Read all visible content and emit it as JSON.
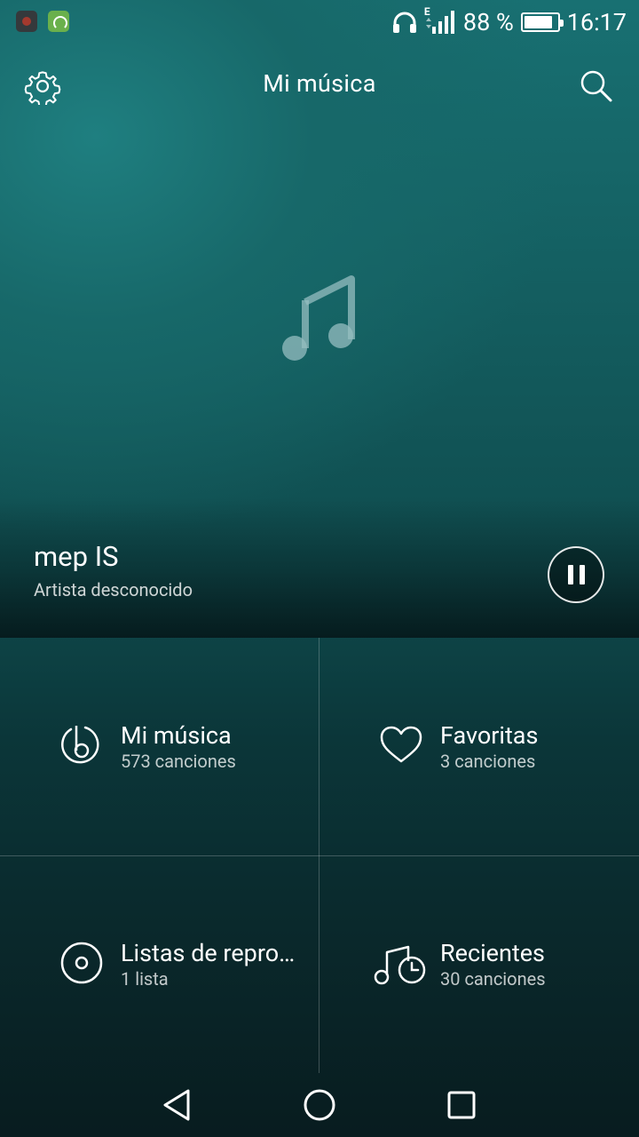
{
  "status_bar": {
    "signal_label": "E",
    "battery_text": "88 %",
    "battery_level": 0.88,
    "time": "16:17",
    "icons": [
      "app-notification-icon",
      "headset-app-icon",
      "headphones-icon",
      "signal-icon",
      "battery-icon"
    ]
  },
  "header": {
    "title": "Mi música",
    "settings_icon": "gear-icon",
    "search_icon": "search-icon"
  },
  "now_playing": {
    "title": "mep IS",
    "artist": "Artista desconocido",
    "control": "pause"
  },
  "categories": [
    {
      "title": "Mi música",
      "subtitle": "573 canciones",
      "icon": "music-library-icon"
    },
    {
      "title": "Favoritas",
      "subtitle": "3 canciones",
      "icon": "heart-icon"
    },
    {
      "title": "Listas de repro…",
      "subtitle": "1 lista",
      "icon": "disc-icon"
    },
    {
      "title": "Recientes",
      "subtitle": "30 canciones",
      "icon": "recent-music-icon"
    }
  ],
  "colors": {
    "accent": "#1f7f80",
    "background_dark": "#081c1f"
  },
  "nav": {
    "back": "back-icon",
    "home": "home-icon",
    "recent": "recent-apps-icon"
  }
}
